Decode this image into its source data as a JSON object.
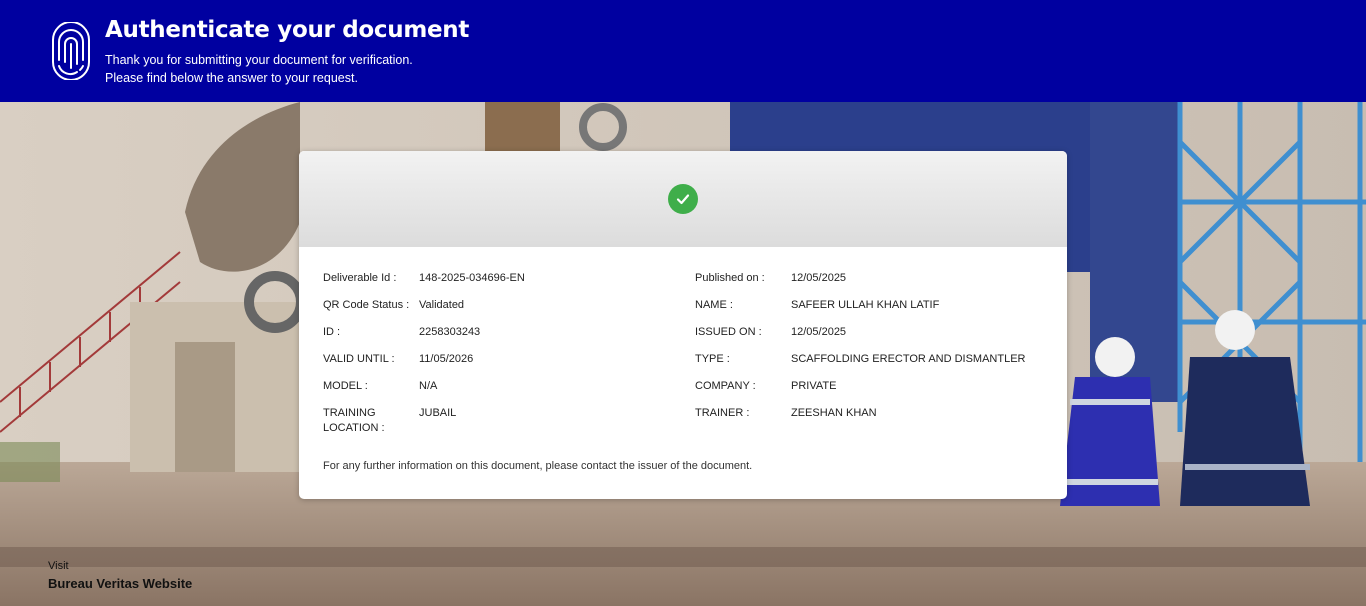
{
  "header": {
    "title": "Authenticate your document",
    "subtitle_line1": "Thank you for submitting your document for verification.",
    "subtitle_line2": "Please find below the answer to your request."
  },
  "card": {
    "status_icon": "check-circle-icon",
    "left_fields": [
      {
        "label": "Deliverable Id :",
        "value": "148-2025-034696-EN"
      },
      {
        "label": "QR Code Status :",
        "value": "Validated"
      },
      {
        "label": "ID :",
        "value": "2258303243"
      },
      {
        "label": "VALID UNTIL :",
        "value": "11/05/2026"
      },
      {
        "label": "MODEL :",
        "value": "N/A"
      },
      {
        "label_line1": "TRAINING",
        "label_line2": "LOCATION :",
        "value": "JUBAIL"
      }
    ],
    "right_fields": [
      {
        "label": "Published on :",
        "value": "12/05/2025"
      },
      {
        "label": "NAME :",
        "value": "SAFEER ULLAH KHAN LATIF"
      },
      {
        "label": "ISSUED ON :",
        "value": "12/05/2025"
      },
      {
        "label": "TYPE :",
        "value": "SCAFFOLDING ERECTOR AND DISMANTLER"
      },
      {
        "label": "COMPANY :",
        "value": "PRIVATE"
      },
      {
        "label": "TRAINER :",
        "value": "ZEESHAN KHAN"
      }
    ],
    "footer_note": "For any further information on this document, please contact the issuer of the document."
  },
  "visit": {
    "label": "Visit",
    "link_text": "Bureau Veritas Website"
  },
  "colors": {
    "header_bg": "#0000a0",
    "check_green": "#3fae4a"
  }
}
